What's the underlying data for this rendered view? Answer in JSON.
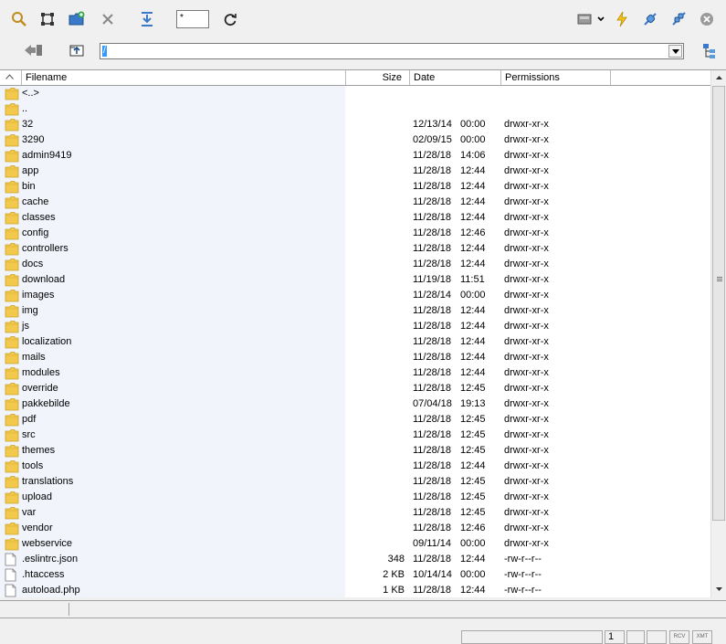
{
  "toolbar": {
    "filter_value": "*",
    "icons": [
      "search-icon",
      "select-frame-icon",
      "new-folder-icon",
      "delete-icon",
      "move-down-icon",
      "refresh-icon",
      "drive-icon",
      "lightning-icon",
      "connect-icon",
      "disconnect-icon",
      "close-icon"
    ]
  },
  "navigation": {
    "path": "/"
  },
  "columns": {
    "filename": "Filename",
    "size": "Size",
    "date": "Date",
    "permissions": "Permissions"
  },
  "files": [
    {
      "name": "<..>",
      "size": "",
      "date": "",
      "time": "",
      "perm": "",
      "type": "folder"
    },
    {
      "name": "..",
      "size": "",
      "date": "",
      "time": "",
      "perm": "",
      "type": "folder"
    },
    {
      "name": "32",
      "size": "",
      "date": "12/13/14",
      "time": "00:00",
      "perm": "drwxr-xr-x",
      "type": "folder"
    },
    {
      "name": "3290",
      "size": "",
      "date": "02/09/15",
      "time": "00:00",
      "perm": "drwxr-xr-x",
      "type": "folder"
    },
    {
      "name": "admin9419",
      "size": "",
      "date": "11/28/18",
      "time": "14:06",
      "perm": "drwxr-xr-x",
      "type": "folder"
    },
    {
      "name": "app",
      "size": "",
      "date": "11/28/18",
      "time": "12:44",
      "perm": "drwxr-xr-x",
      "type": "folder"
    },
    {
      "name": "bin",
      "size": "",
      "date": "11/28/18",
      "time": "12:44",
      "perm": "drwxr-xr-x",
      "type": "folder"
    },
    {
      "name": "cache",
      "size": "",
      "date": "11/28/18",
      "time": "12:44",
      "perm": "drwxr-xr-x",
      "type": "folder"
    },
    {
      "name": "classes",
      "size": "",
      "date": "11/28/18",
      "time": "12:44",
      "perm": "drwxr-xr-x",
      "type": "folder"
    },
    {
      "name": "config",
      "size": "",
      "date": "11/28/18",
      "time": "12:46",
      "perm": "drwxr-xr-x",
      "type": "folder"
    },
    {
      "name": "controllers",
      "size": "",
      "date": "11/28/18",
      "time": "12:44",
      "perm": "drwxr-xr-x",
      "type": "folder"
    },
    {
      "name": "docs",
      "size": "",
      "date": "11/28/18",
      "time": "12:44",
      "perm": "drwxr-xr-x",
      "type": "folder"
    },
    {
      "name": "download",
      "size": "",
      "date": "11/19/18",
      "time": "11:51",
      "perm": "drwxr-xr-x",
      "type": "folder"
    },
    {
      "name": "images",
      "size": "",
      "date": "11/28/14",
      "time": "00:00",
      "perm": "drwxr-xr-x",
      "type": "folder"
    },
    {
      "name": "img",
      "size": "",
      "date": "11/28/18",
      "time": "12:44",
      "perm": "drwxr-xr-x",
      "type": "folder"
    },
    {
      "name": "js",
      "size": "",
      "date": "11/28/18",
      "time": "12:44",
      "perm": "drwxr-xr-x",
      "type": "folder"
    },
    {
      "name": "localization",
      "size": "",
      "date": "11/28/18",
      "time": "12:44",
      "perm": "drwxr-xr-x",
      "type": "folder"
    },
    {
      "name": "mails",
      "size": "",
      "date": "11/28/18",
      "time": "12:44",
      "perm": "drwxr-xr-x",
      "type": "folder"
    },
    {
      "name": "modules",
      "size": "",
      "date": "11/28/18",
      "time": "12:44",
      "perm": "drwxr-xr-x",
      "type": "folder"
    },
    {
      "name": "override",
      "size": "",
      "date": "11/28/18",
      "time": "12:45",
      "perm": "drwxr-xr-x",
      "type": "folder"
    },
    {
      "name": "pakkebilde",
      "size": "",
      "date": "07/04/18",
      "time": "19:13",
      "perm": "drwxr-xr-x",
      "type": "folder"
    },
    {
      "name": "pdf",
      "size": "",
      "date": "11/28/18",
      "time": "12:45",
      "perm": "drwxr-xr-x",
      "type": "folder"
    },
    {
      "name": "src",
      "size": "",
      "date": "11/28/18",
      "time": "12:45",
      "perm": "drwxr-xr-x",
      "type": "folder"
    },
    {
      "name": "themes",
      "size": "",
      "date": "11/28/18",
      "time": "12:45",
      "perm": "drwxr-xr-x",
      "type": "folder"
    },
    {
      "name": "tools",
      "size": "",
      "date": "11/28/18",
      "time": "12:44",
      "perm": "drwxr-xr-x",
      "type": "folder"
    },
    {
      "name": "translations",
      "size": "",
      "date": "11/28/18",
      "time": "12:45",
      "perm": "drwxr-xr-x",
      "type": "folder"
    },
    {
      "name": "upload",
      "size": "",
      "date": "11/28/18",
      "time": "12:45",
      "perm": "drwxr-xr-x",
      "type": "folder"
    },
    {
      "name": "var",
      "size": "",
      "date": "11/28/18",
      "time": "12:45",
      "perm": "drwxr-xr-x",
      "type": "folder"
    },
    {
      "name": "vendor",
      "size": "",
      "date": "11/28/18",
      "time": "12:46",
      "perm": "drwxr-xr-x",
      "type": "folder"
    },
    {
      "name": "webservice",
      "size": "",
      "date": "09/11/14",
      "time": "00:00",
      "perm": "drwxr-xr-x",
      "type": "folder"
    },
    {
      "name": ".eslintrc.json",
      "size": "348",
      "date": "11/28/18",
      "time": "12:44",
      "perm": "-rw-r--r--",
      "type": "file"
    },
    {
      "name": ".htaccess",
      "size": "2 KB",
      "date": "10/14/14",
      "time": "00:00",
      "perm": "-rw-r--r--",
      "type": "file"
    },
    {
      "name": "autoload.php",
      "size": "1 KB",
      "date": "11/28/18",
      "time": "12:44",
      "perm": "-rw-r--r--",
      "type": "file"
    }
  ],
  "status": {
    "page": "1",
    "rcv": "RCV",
    "xmt": "XMT"
  },
  "colors": {
    "folder": "#f2c94c",
    "accent": "#3399ff",
    "highlight_column": "#f2f4fc"
  }
}
